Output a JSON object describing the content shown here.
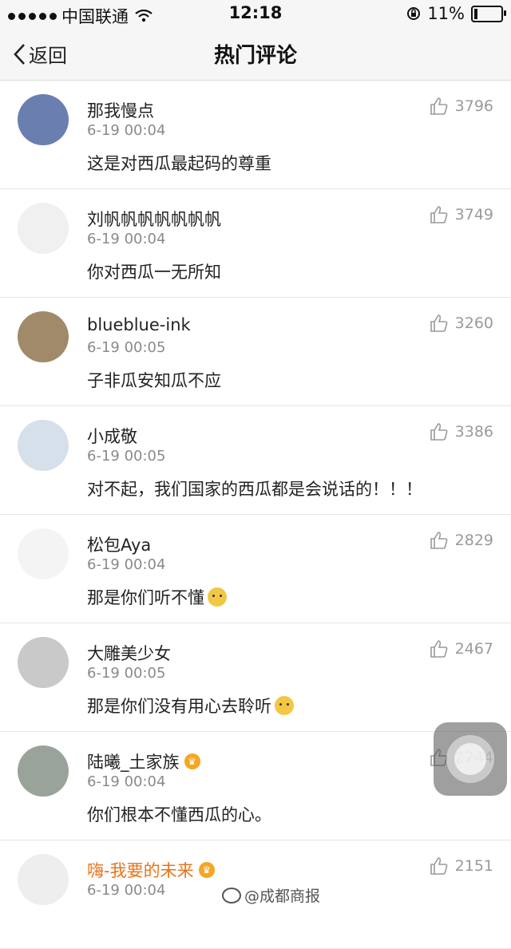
{
  "status_bar": {
    "carrier": "中国联通",
    "time": "12:18",
    "battery": "11%",
    "battery_level": 0.11
  },
  "nav": {
    "back_label": "返回",
    "title": "热门评论"
  },
  "comments": [
    {
      "user": "那我慢点",
      "time": "6-19 00:04",
      "text": "这是对西瓜最起码的尊重",
      "likes": "3796",
      "emoji": false,
      "badge": false
    },
    {
      "user": "刘帆帆帆帆帆帆帆",
      "time": "6-19 00:04",
      "text": "你对西瓜一无所知",
      "likes": "3749",
      "emoji": false,
      "badge": false
    },
    {
      "user": "blueblue-ink",
      "time": "6-19 00:05",
      "text": "子非瓜安知瓜不应",
      "likes": "3260",
      "emoji": false,
      "badge": false
    },
    {
      "user": "小成敬",
      "time": "6-19 00:05",
      "text": "对不起，我们国家的西瓜都是会说话的！！！",
      "likes": "3386",
      "emoji": false,
      "badge": false
    },
    {
      "user": "松包Aya",
      "time": "6-19 00:04",
      "text": "那是你们听不懂",
      "likes": "2829",
      "emoji": true,
      "badge": false
    },
    {
      "user": "大雕美少女",
      "time": "6-19 00:05",
      "text": "那是你们没有用心去聆听",
      "likes": "2467",
      "emoji": true,
      "badge": false
    },
    {
      "user": "陆曦_土家族",
      "time": "6-19 00:04",
      "text": "你们根本不懂西瓜的心。",
      "likes": "2244",
      "emoji": false,
      "badge": true
    },
    {
      "user": "嗨-我要的未来",
      "time": "6-19 00:04",
      "text": "",
      "likes": "2151",
      "emoji": false,
      "badge": true,
      "vip": true
    }
  ],
  "watermark": "@成都商报",
  "colors": {
    "vip_name": "#e8741a",
    "meta_gray": "#8a8a8a",
    "bar_bg": "#f6f6f6"
  }
}
